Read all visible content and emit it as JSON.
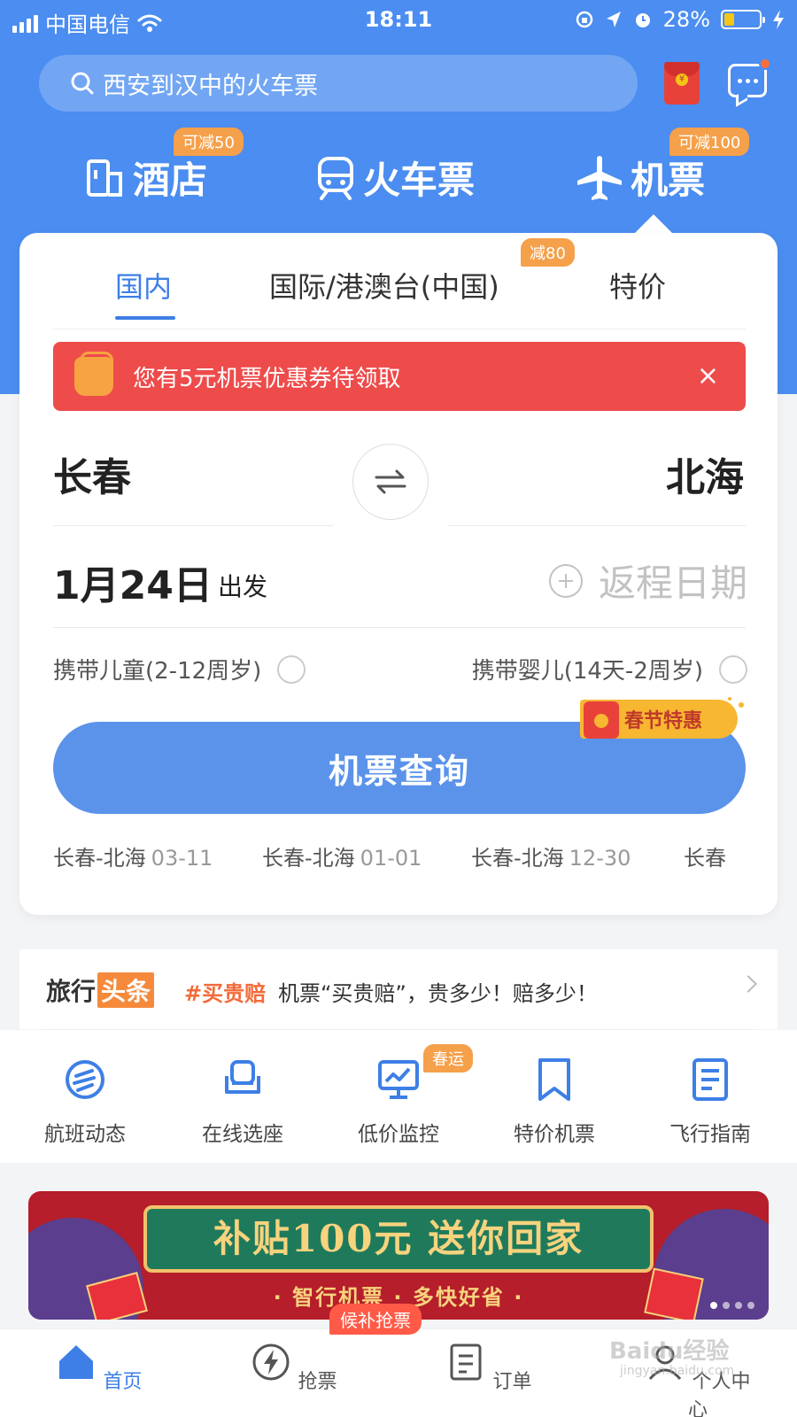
{
  "status_bar": {
    "carrier": "中国电信",
    "time": "18:11",
    "battery_percent": "28%",
    "battery_level": 0.28
  },
  "search": {
    "placeholder": "西安到汉中的火车票"
  },
  "categories": [
    {
      "label": "酒店",
      "badge": "可减50",
      "icon": "hotel-icon"
    },
    {
      "label": "火车票",
      "badge": "",
      "icon": "train-icon"
    },
    {
      "label": "机票",
      "badge": "可减100",
      "icon": "plane-icon"
    }
  ],
  "flight_tabs": [
    {
      "label": "国内",
      "active": true
    },
    {
      "label": "国际/港澳台(中国)",
      "badge": "减80"
    },
    {
      "label": "特价"
    }
  ],
  "coupon_banner": {
    "text": "您有5元机票优惠券待领取",
    "close": "×"
  },
  "route": {
    "from": "长春",
    "to": "北海"
  },
  "dates": {
    "depart": "1月24日",
    "depart_suffix": "出发",
    "return_placeholder": "返程日期"
  },
  "options": [
    {
      "label": "携带儿童(2-12周岁)"
    },
    {
      "label": "携带婴儿(14天-2周岁)"
    }
  ],
  "promo_badge": "春节特惠",
  "search_button": "机票查询",
  "history": [
    {
      "route": "长春-北海",
      "date": "03-11"
    },
    {
      "route": "长春-北海",
      "date": "01-01"
    },
    {
      "route": "长春-北海",
      "date": "12-30"
    },
    {
      "route": "长春",
      "date": ""
    }
  ],
  "news": {
    "brand": "旅行",
    "brand_tag": "头条",
    "hashtag": "#买贵赔",
    "text": "机票“买贵赔”，贵多少！赔多少！"
  },
  "tools": [
    {
      "label": "航班动态",
      "icon": "flight-status-icon"
    },
    {
      "label": "在线选座",
      "icon": "seat-icon"
    },
    {
      "label": "低价监控",
      "icon": "price-monitor-icon",
      "badge": "春运"
    },
    {
      "label": "特价机票",
      "icon": "bookmark-icon"
    },
    {
      "label": "飞行指南",
      "icon": "guide-icon"
    }
  ],
  "banner": {
    "title": "补贴100元 送你回家",
    "subtitle": "· 智行机票 · 多快好省 ·"
  },
  "bottom_nav": [
    {
      "label": "首页",
      "icon": "home-icon",
      "active": true
    },
    {
      "label": "抢票",
      "icon": "lightning-icon",
      "badge": "候补抢票"
    },
    {
      "label": "订单",
      "icon": "order-icon"
    },
    {
      "label": "个人中心",
      "icon": "profile-icon"
    }
  ],
  "watermark": {
    "text": "Baidu经验",
    "sub": "jingyan.baidu.com"
  },
  "colors": {
    "brand_blue": "#4b8df0",
    "accent_orange": "#f5a04a",
    "coupon_red": "#ee4b4b"
  }
}
